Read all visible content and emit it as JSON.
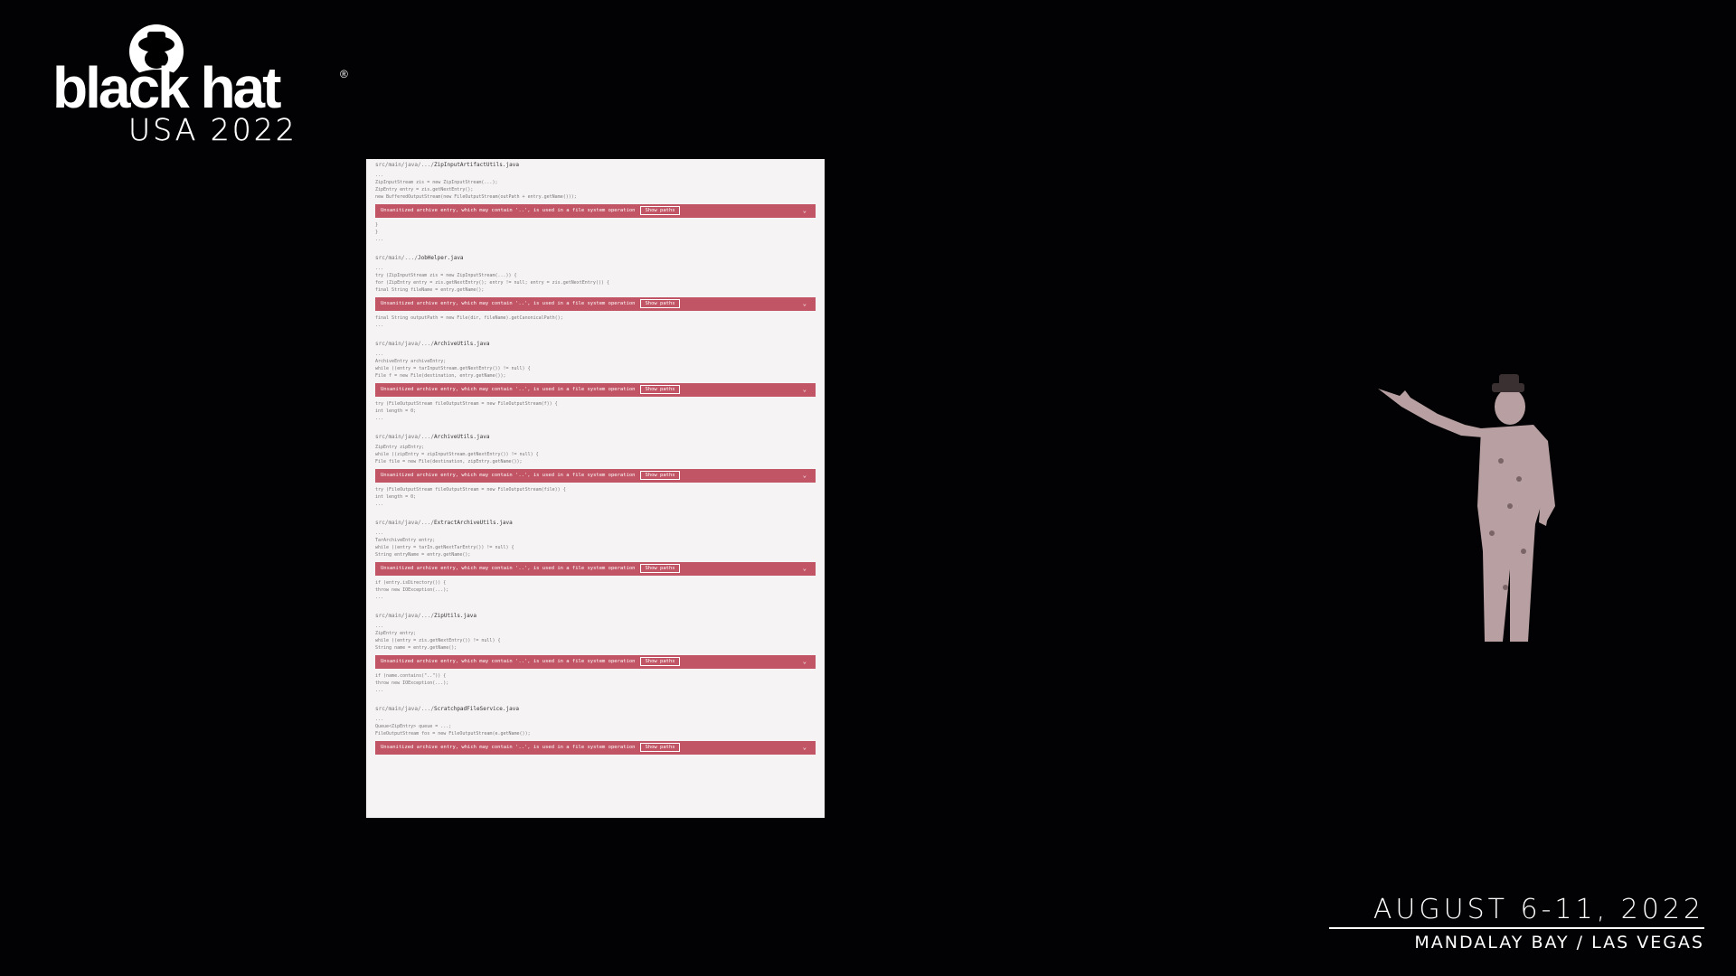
{
  "logo": {
    "wordmark": "black hat",
    "registered": "®",
    "subtitle": "USA 2022"
  },
  "slide": {
    "sections": [
      {
        "header_prefix": "src/main/java/.../",
        "file": "ZipInputArtifactUtils.java",
        "lines_before": [
          "...",
          "    ZipInputStream zis = new ZipInputStream(...);",
          "        ZipEntry entry = zis.getNextEntry();",
          "        new BufferedOutputStream(new FileOutputStream(outPath + entry.getName()));"
        ],
        "alert": "Unsanitized archive entry, which may contain '..', is used in a file system operation",
        "alert_tag": "Show paths",
        "lines_after": [
          "    }",
          "  }",
          "..."
        ]
      },
      {
        "header_prefix": "src/main/.../",
        "file": "JobHelper.java",
        "lines_before": [
          "...",
          "    try (ZipInputStream zis = new ZipInputStream(...)) {",
          "        for (ZipEntry entry = zis.getNextEntry(); entry != null; entry = zis.getNextEntry()) {",
          "            final String fileName = entry.getName();"
        ],
        "alert": "Unsanitized archive entry, which may contain '..', is used in a file system operation",
        "alert_tag": "Show paths",
        "lines_after": [
          "            final String outputPath = new File(dir, fileName).getCanonicalPath();",
          "  ..."
        ]
      },
      {
        "header_prefix": "src/main/java/.../",
        "file": "ArchiveUtils.java",
        "lines_before": [
          "...",
          "        ArchiveEntry archiveEntry;",
          "        while ((entry = tarInputStream.getNextEntry()) != null) {",
          "            File f = new File(destination, entry.getName());"
        ],
        "alert": "Unsanitized archive entry, which may contain '..', is used in a file system operation",
        "alert_tag": "Show paths",
        "lines_after": [
          "            try (FileOutputStream fileOutputStream = new FileOutputStream(f)) {",
          "                int length = 0;",
          "..."
        ]
      },
      {
        "header_prefix": "src/main/java/.../",
        "file": "ArchiveUtils.java",
        "lines_before": [
          "        ZipEntry zipEntry;",
          "        while ((zipEntry = zipInputStream.getNextEntry()) != null) {",
          "            File file = new File(destination, zipEntry.getName());"
        ],
        "alert": "Unsanitized archive entry, which may contain '..', is used in a file system operation",
        "alert_tag": "Show paths",
        "lines_after": [
          "            try (FileOutputStream fileOutputStream = new FileOutputStream(file)) {",
          "                int length = 0;",
          "..."
        ]
      },
      {
        "header_prefix": "src/main/java/.../",
        "file": "ExtractArchiveUtils.java",
        "lines_before": [
          "...",
          "        TarArchiveEntry entry;",
          "        while ((entry = tarIn.getNextTarEntry()) != null) {",
          "            String entryName = entry.getName();"
        ],
        "alert": "Unsanitized archive entry, which may contain '..', is used in a file system operation",
        "alert_tag": "Show paths",
        "lines_after": [
          "        if (entry.isDirectory()) {",
          "            throw new IOException(...);",
          "..."
        ]
      },
      {
        "header_prefix": "src/main/java/.../",
        "file": "ZipUtils.java",
        "lines_before": [
          "...",
          "        ZipEntry entry;",
          "        while ((entry = zis.getNextEntry()) != null) {",
          "            String name = entry.getName();"
        ],
        "alert": "Unsanitized archive entry, which may contain '..', is used in a file system operation",
        "alert_tag": "Show paths",
        "lines_after": [
          "        if (name.contains(\"..\")) {",
          "            throw new IOException(...);",
          "..."
        ]
      },
      {
        "header_prefix": "src/main/java/.../",
        "file": "ScratchpadFileService.java",
        "lines_before": [
          "...",
          "        Queue<ZipEntry> queue = ...;",
          "        FileOutputStream fos = new FileOutputStream(e.getName());"
        ],
        "alert": "Unsanitized archive entry, which may contain '..', is used in a file system operation",
        "alert_tag": "Show paths",
        "lines_after": []
      }
    ]
  },
  "event": {
    "date": "AUGUST 6-11, 2022",
    "venue": "MANDALAY BAY / LAS VEGAS"
  }
}
